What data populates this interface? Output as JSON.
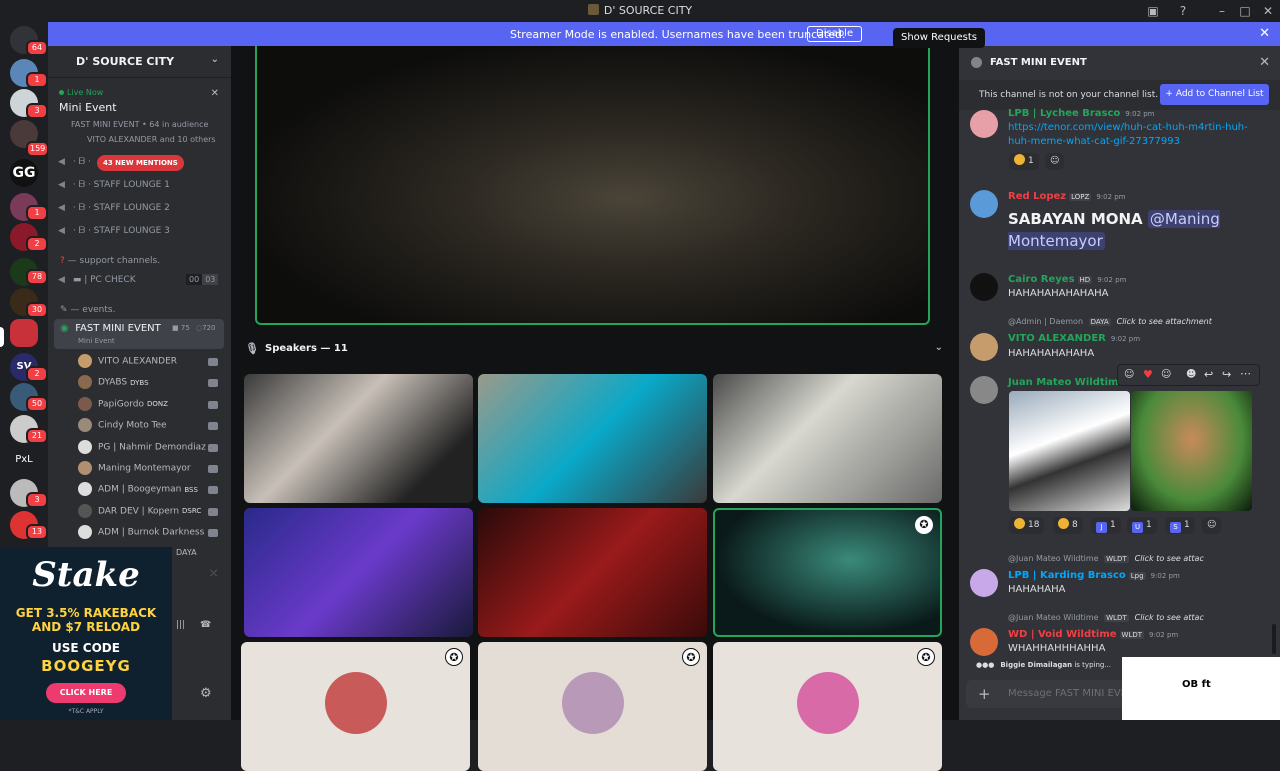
{
  "window": {
    "title": "D' SOURCE CITY"
  },
  "banner": {
    "text": "Streamer Mode is enabled. Usernames have been truncated.",
    "disable_label": "Disable",
    "tooltip": "Show Requests"
  },
  "guild_badges": [
    "64",
    "1",
    "3",
    "159",
    "1",
    "2",
    "78",
    "30",
    "2",
    "50",
    "21",
    "3",
    "13"
  ],
  "guild_text": {
    "sv": "SV",
    "gg": "GG",
    "pxl": "PxL"
  },
  "sidebar": {
    "server_name": "D' SOURCE CITY",
    "live": {
      "status": "Live Now",
      "title": "Mini Event",
      "channel": "FAST MINI EVENT",
      "audience": "64 in audience",
      "participants": "VITO ALEXANDER and 10 others"
    },
    "mentions_pill": "43 NEW MENTIONS",
    "channels": [
      {
        "label": "STAFF LOUNGE 1"
      },
      {
        "label": "STAFF LOUNGE 2"
      },
      {
        "label": "STAFF LOUNGE 3"
      }
    ],
    "support_cat": "— support channels.",
    "pc_check": {
      "label": "PC CHECK",
      "c1": "00",
      "c2": "03"
    },
    "events_cat": "— events.",
    "active_channel": {
      "name": "FAST MINI EVENT",
      "sub": "Mini Event",
      "cams": "75",
      "listeners": "720"
    },
    "voice_users": [
      {
        "name": "VITO ALEXANDER",
        "tag": "",
        "color": "#c69c6d"
      },
      {
        "name": "DYABS",
        "tag": "DYBS",
        "color": "#8a6a4e"
      },
      {
        "name": "PapiGordo",
        "tag": "DONZ",
        "color": "#7a5a4a"
      },
      {
        "name": "Cindy Moto Tee",
        "tag": "",
        "color": "#9a8a7a"
      },
      {
        "name": "PG | Nahmir Demondiaz",
        "tag": "",
        "color": "#ddd"
      },
      {
        "name": "Maning Montemayor",
        "tag": "",
        "color": "#b09070"
      },
      {
        "name": "ADM | Boogeyman",
        "tag": "BSS",
        "color": "#ddd"
      },
      {
        "name": "DAR DEV | Kopern",
        "tag": "DSRC",
        "color": "#555"
      },
      {
        "name": "ADM | Burnok Darkness",
        "tag": "",
        "color": "#ddd"
      }
    ],
    "hidden_tag": "DAYA"
  },
  "ad": {
    "logo": "Stake",
    "line1": "GET 3.5% RAKEBACK",
    "line2": "AND $7 RELOAD",
    "line3": "USE CODE",
    "code": "BOOGEYG",
    "cta": "CLICK HERE",
    "tc": "*T&C APPLY"
  },
  "stage": {
    "speakers_label": "Speakers — 11"
  },
  "chat": {
    "channel": "FAST MINI EVENT",
    "notice": "This channel is not on your channel list.",
    "add_button": "Add to Channel List",
    "messages": [
      {
        "author": "LPB | Lychee Brasco",
        "tag": "",
        "time": "9:02 pm",
        "body": "https://tenor.com/view/huh-cat-huh-m4rtin-huh-huh-meme-what-cat-gif-27377993",
        "reaction": "1"
      },
      {
        "author": "Red Lopez",
        "tag": "LOPZ",
        "time": "9:02 pm",
        "body": "SABAYAN MONA",
        "mention": "@Maning Montemayor"
      },
      {
        "author": "Cairo Reyes",
        "tag": "HD",
        "time": "9:02 pm",
        "body": "HAHAHAHAHAHAHA"
      },
      {
        "reply_to": "@Admin | Daemon",
        "reply_tag": "DAYA",
        "reply_text": "Click to see attachment",
        "author": "VITO ALEXANDER",
        "time": "9:02 pm",
        "body": "HAHAHAHAHAHA"
      },
      {
        "author": "Juan Mateo Wildtime",
        "reactions": [
          "18",
          "8",
          "1",
          "1",
          "1"
        ]
      },
      {
        "reply_to": "@Juan Mateo Wildtime",
        "reply_tag": "WLDT",
        "reply_text": "Click to see attac",
        "author": "LPB | Karding Brasco",
        "tag": "Lpg",
        "time": "9:02 pm",
        "body": "HAHAHAHA"
      },
      {
        "reply_to": "@Juan Mateo Wildtime",
        "reply_tag": "WLDT",
        "reply_text": "Click to see attac",
        "author": "WD | Void Wildtime",
        "tag": "WLDT",
        "time": "9:02 pm",
        "body": "WHAHHAHHHAHHA"
      }
    ],
    "typing_user": "Biggie Dimailagan",
    "typing_text": " is typing...",
    "composer_placeholder": "Message FAST MINI EVENT",
    "overlay_text": "OB  ft"
  }
}
